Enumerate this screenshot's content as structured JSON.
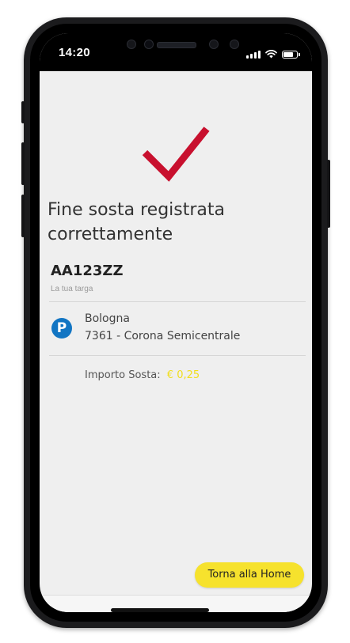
{
  "status_bar": {
    "time": "14:20",
    "icons": [
      "signal-icon",
      "wifi-icon",
      "battery-icon"
    ]
  },
  "confirmation": {
    "icon": "checkmark-icon",
    "title_line1": "Fine sosta registrata",
    "title_line2": "correttamente"
  },
  "vehicle": {
    "plate": "AA123ZZ",
    "plate_label": "La tua targa"
  },
  "parking": {
    "icon": "parking-icon",
    "icon_letter": "P",
    "city": "Bologna",
    "zone": "7361 - Corona Semicentrale"
  },
  "amount": {
    "label": "Importo Sosta:",
    "value": "€ 0,25"
  },
  "actions": {
    "home_button": "Torna alla Home"
  },
  "colors": {
    "check": "#c8102e",
    "accent_yellow": "#f6e22d",
    "parking_blue": "#1275c3"
  }
}
